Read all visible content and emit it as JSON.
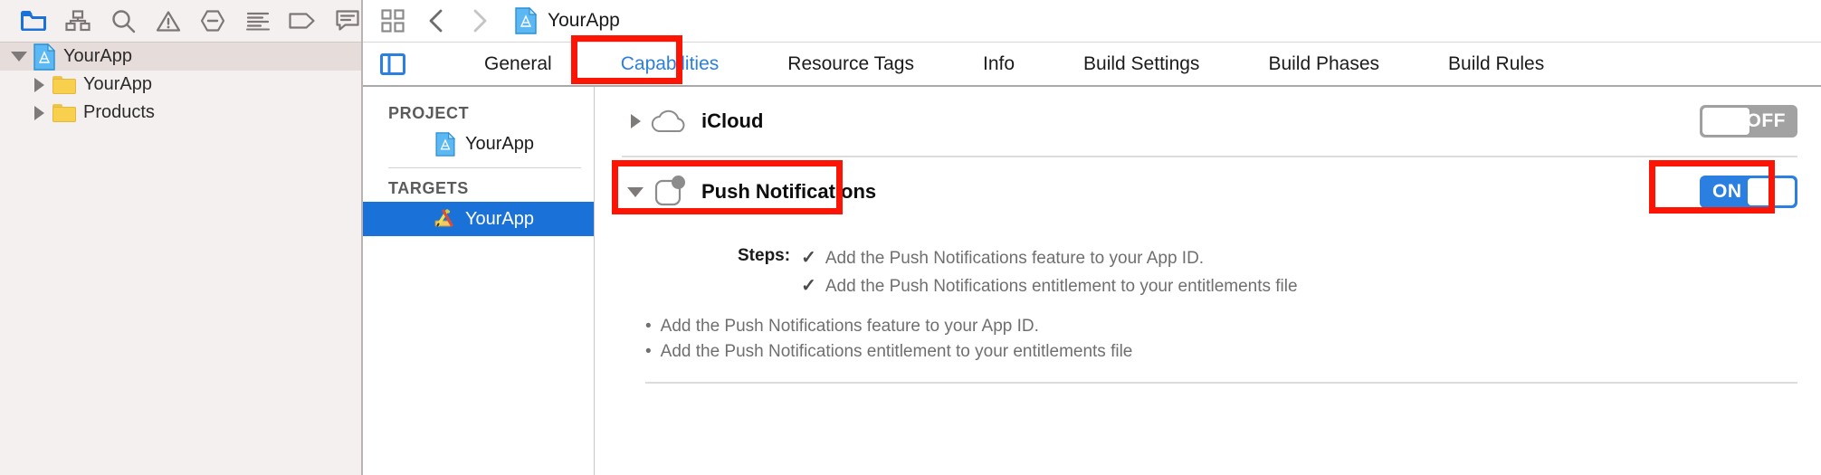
{
  "navigator": {
    "toolbar_icons": [
      {
        "name": "project-navigator-icon",
        "label": "Project Navigator",
        "active": true
      },
      {
        "name": "symbol-navigator-icon",
        "label": "Symbol Navigator",
        "active": false
      },
      {
        "name": "search-navigator-icon",
        "label": "Find Navigator",
        "active": false
      },
      {
        "name": "issue-navigator-icon",
        "label": "Issue Navigator",
        "active": false
      },
      {
        "name": "test-navigator-icon",
        "label": "Test Navigator",
        "active": false
      },
      {
        "name": "debug-navigator-icon",
        "label": "Debug Navigator",
        "active": false
      },
      {
        "name": "breakpoint-navigator-icon",
        "label": "Breakpoint Navigator",
        "active": false
      },
      {
        "name": "report-navigator-icon",
        "label": "Report Navigator",
        "active": false
      }
    ],
    "tree": [
      {
        "label": "YourApp",
        "icon": "xcode-project-icon",
        "level": 1,
        "expanded": true,
        "selected": true
      },
      {
        "label": "YourApp",
        "icon": "folder-icon",
        "level": 2,
        "expanded": false,
        "selected": false
      },
      {
        "label": "Products",
        "icon": "folder-icon",
        "level": 2,
        "expanded": false,
        "selected": false
      }
    ]
  },
  "breadcrumb": {
    "grid_icon": "related-items-icon",
    "back_label": "Back",
    "forward_label": "Forward",
    "doc_icon": "xcode-project-icon",
    "title": "YourApp"
  },
  "tabbar": {
    "panel_toggle": "editor-pane-toggle-icon",
    "tabs": [
      {
        "label": "General",
        "active": false
      },
      {
        "label": "Capabilities",
        "active": true
      },
      {
        "label": "Resource Tags",
        "active": false
      },
      {
        "label": "Info",
        "active": false
      },
      {
        "label": "Build Settings",
        "active": false
      },
      {
        "label": "Build Phases",
        "active": false
      },
      {
        "label": "Build Rules",
        "active": false
      }
    ]
  },
  "targets_pane": {
    "project_header": "PROJECT",
    "project_items": [
      {
        "label": "YourApp",
        "icon": "xcode-project-icon",
        "selected": false
      }
    ],
    "targets_header": "TARGETS",
    "target_items": [
      {
        "label": "YourApp",
        "icon": "xcode-target-icon",
        "selected": true
      }
    ]
  },
  "capabilities": [
    {
      "name": "iCloud",
      "icon": "cloud-icon",
      "expanded": false,
      "toggle": {
        "state": "OFF",
        "label": "OFF",
        "on": false
      }
    },
    {
      "name": "Push Notifications",
      "icon": "push-notifications-icon",
      "expanded": true,
      "toggle": {
        "state": "ON",
        "label": "ON",
        "on": true
      },
      "steps_label": "Steps:",
      "steps": [
        {
          "check": "✓",
          "text": "Add the Push Notifications feature to your App ID."
        },
        {
          "check": "✓",
          "text": "Add the Push Notifications entitlement to your entitlements file"
        }
      ],
      "bullets": [
        {
          "dot": "•",
          "text": "Add the Push Notifications feature to your App ID."
        },
        {
          "dot": "•",
          "text": "Add the Push Notifications entitlement to your entitlements file"
        }
      ]
    }
  ],
  "annotations": {
    "accent_color": "#fc1505",
    "boxes": [
      {
        "name": "capabilities-tab-highlight",
        "target": "Capabilities"
      },
      {
        "name": "push-notifications-row-highlight",
        "target": "Push Notifications"
      },
      {
        "name": "push-notifications-toggle-highlight",
        "target": "ON"
      }
    ]
  },
  "colors": {
    "active_tab": "#2b7fe0",
    "selection_blue": "#1a72d8",
    "annotation_red": "#fc1505",
    "navigator_bg": "#f4f0ef"
  }
}
